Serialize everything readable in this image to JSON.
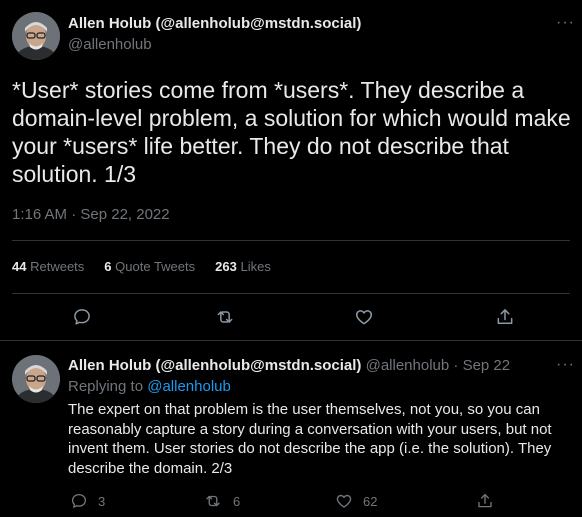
{
  "main_tweet": {
    "author_name": "Allen Holub (@allenholub@mstdn.social)",
    "author_handle": "@allenholub",
    "more": "···",
    "text_lines": [
      "*User* stories come from *users*. They describe a",
      "domain-level problem, a solution for which would make",
      "your *users* life better. They do not describe that",
      "solution. 1/3"
    ],
    "timestamp": "1:16 AM · Sep 22, 2022",
    "stats": {
      "retweets_count": "44",
      "retweets_label": "Retweets",
      "quotes_count": "6",
      "quotes_label": "Quote Tweets",
      "likes_count": "263",
      "likes_label": "Likes"
    }
  },
  "reply_tweet": {
    "author_name": "Allen Holub (@allenholub@mstdn.social)",
    "author_handle": "@allenholub",
    "separator": "·",
    "date": "Sep 22",
    "more": "···",
    "replying_prefix": "Replying to",
    "replying_to": "@allenholub",
    "text_lines": [
      "The expert on that problem is the user themselves, not you, so you can",
      "reasonably capture a story during a conversation with your users, but not",
      "invent them. User stories do not describe the app (i.e. the solution). They",
      "describe the domain. 2/3"
    ],
    "actions": {
      "reply_count": "3",
      "retweet_count": "6",
      "like_count": "62"
    }
  },
  "colors": {
    "background": "#000000",
    "text": "#e7e9ea",
    "muted": "#71767b",
    "link": "#1d9bf0",
    "divider": "#2f3336"
  }
}
